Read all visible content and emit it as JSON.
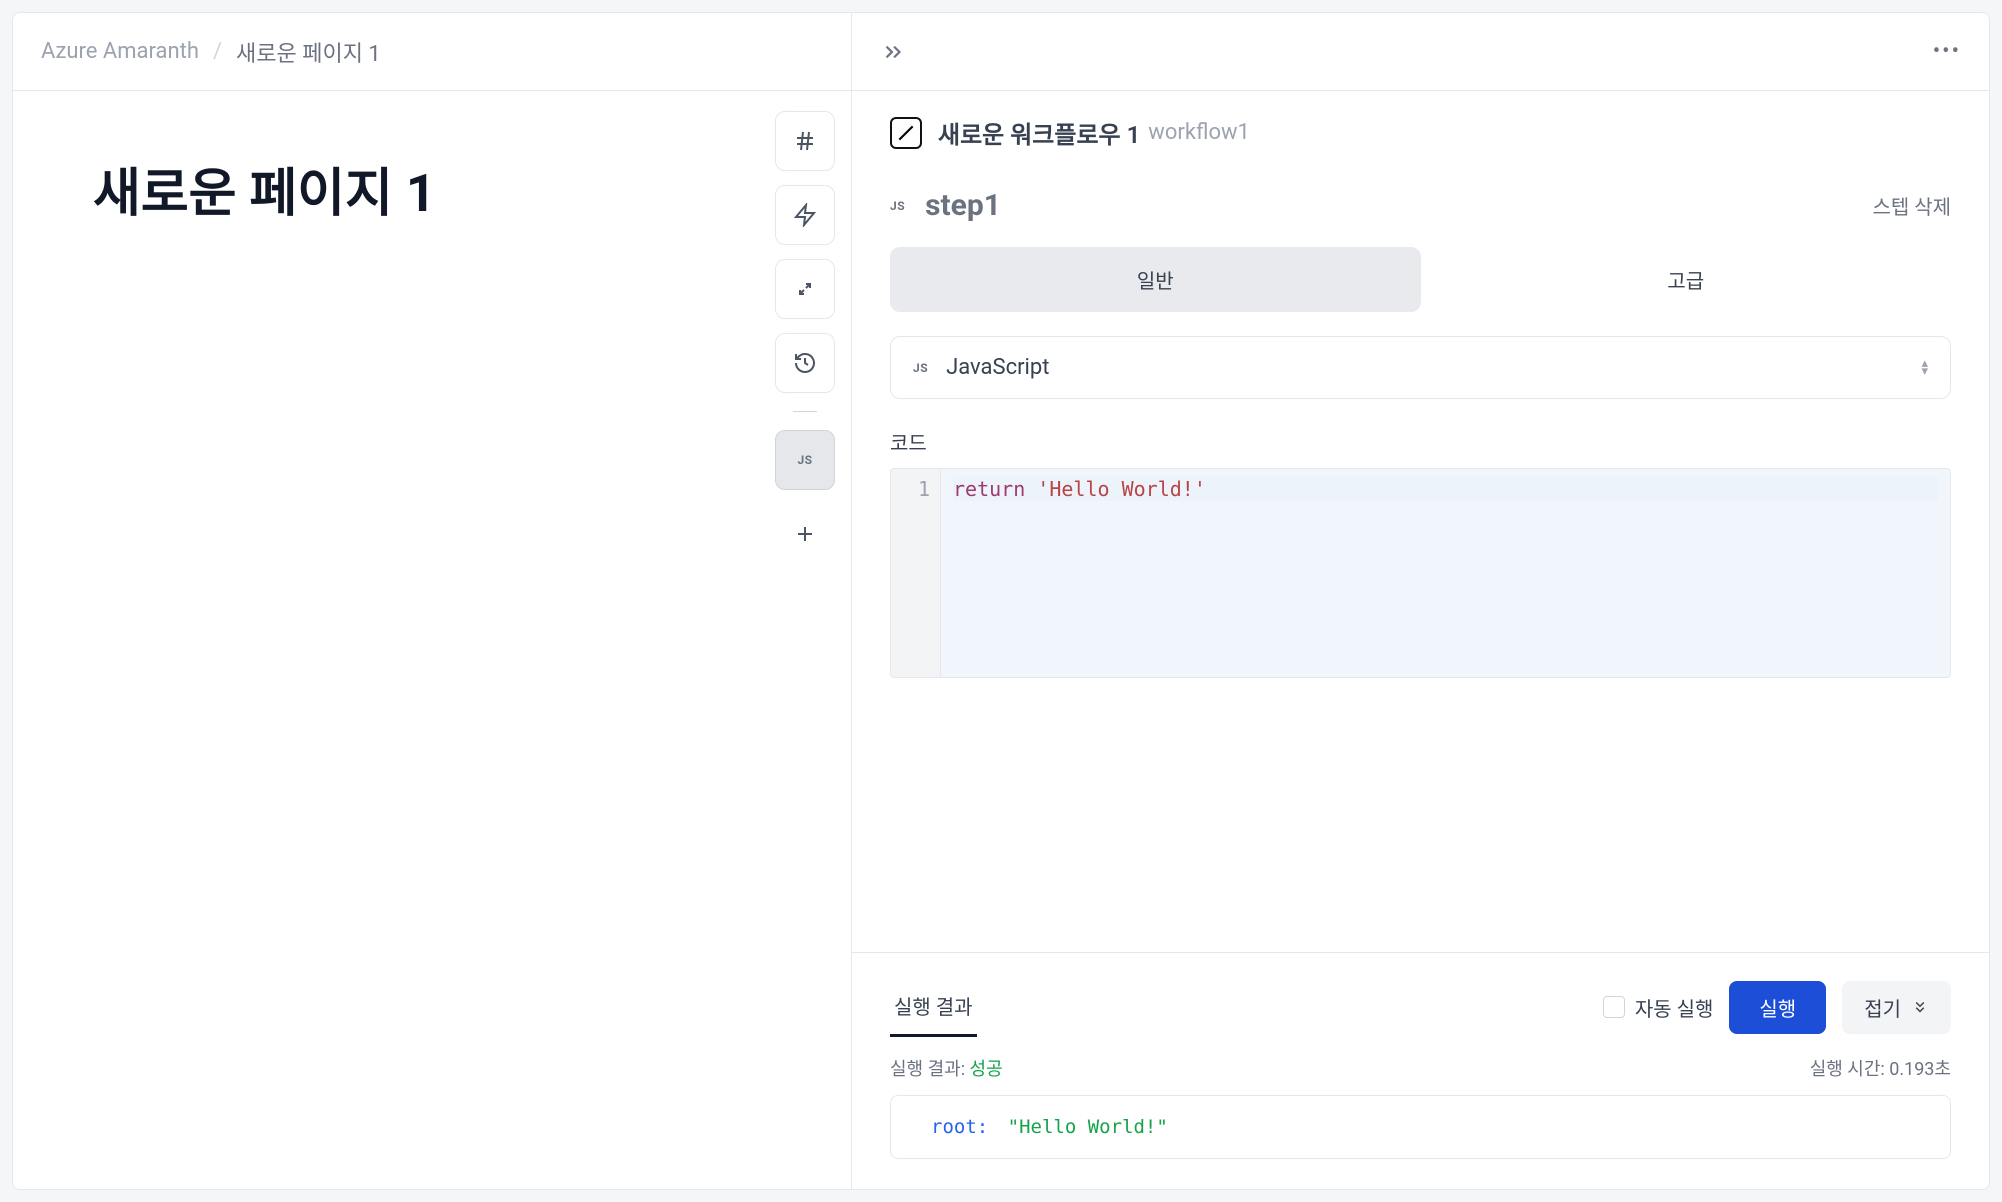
{
  "breadcrumb": {
    "project": "Azure Amaranth",
    "separator": "/",
    "page": "새로운 페이지 1"
  },
  "page": {
    "title": "새로운 페이지 1"
  },
  "sideButtons": {
    "jsBadge": "JS"
  },
  "workflow": {
    "title": "새로운 워크플로우 1",
    "id": "workflow1"
  },
  "step": {
    "jsBadge": "JS",
    "name": "step1",
    "deleteLabel": "스텝 삭제"
  },
  "tabs": {
    "general": "일반",
    "advanced": "고급"
  },
  "langSelect": {
    "jsBadge": "JS",
    "label": "JavaScript"
  },
  "code": {
    "label": "코드",
    "lineNumber": "1",
    "keyword": "return",
    "string": "'Hello World!'"
  },
  "results": {
    "tabLabel": "실행 결과",
    "autoRunLabel": "자동 실행",
    "runLabel": "실행",
    "collapseLabel": "접기",
    "metaLabel": "실행 결과:",
    "metaStatus": "성공",
    "timeLabel": "실행 시간: 0.193초",
    "rootKey": "root:",
    "rootValue": "\"Hello World!\""
  }
}
